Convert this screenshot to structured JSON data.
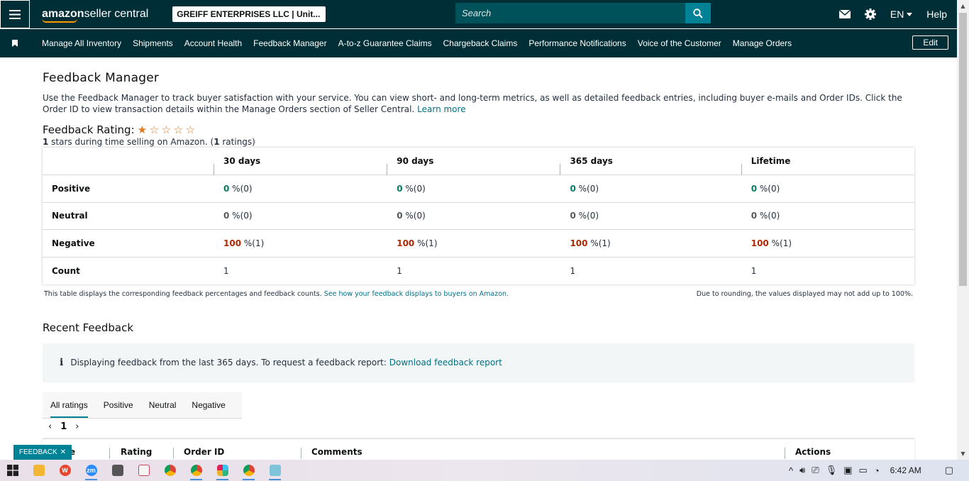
{
  "topbar": {
    "logo_bold": "amazon",
    "logo_rest": " seller central",
    "account": "GREIFF ENTERPRISES LLC | Unit...",
    "search_placeholder": "Search",
    "language": "EN",
    "help": "Help"
  },
  "navbar": {
    "items": [
      "Manage All Inventory",
      "Shipments",
      "Account Health",
      "Feedback Manager",
      "A-to-z Guarantee Claims",
      "Chargeback Claims",
      "Performance Notifications",
      "Voice of the Customer",
      "Manage Orders"
    ],
    "edit": "Edit"
  },
  "page": {
    "title": "Feedback Manager",
    "description": "Use the Feedback Manager to track buyer satisfaction with your service. You can view short- and long-term metrics, as well as detailed feedback entries, including buyer e-mails and Order IDs. Click the Order ID to view transaction details within the Manage Orders section of Seller Central.",
    "learn_more": "Learn more",
    "rating_label": "Feedback Rating:",
    "rating_value": 1,
    "rating_max": 5,
    "stars_count": "1",
    "stars_text": " stars during time selling on Amazon. (",
    "ratings_count": "1",
    "ratings_text": " ratings)"
  },
  "feedback_table": {
    "columns": [
      "30 days",
      "90 days",
      "365 days",
      "Lifetime"
    ],
    "rows": [
      {
        "label": "Positive",
        "cells": [
          {
            "num": "0",
            "rest": " %(0)"
          },
          {
            "num": "0",
            "rest": " %(0)"
          },
          {
            "num": "0",
            "rest": " %(0)"
          },
          {
            "num": "0",
            "rest": " %(0)"
          }
        ]
      },
      {
        "label": "Neutral",
        "cells": [
          {
            "num": "0",
            "rest": " %(0)"
          },
          {
            "num": "0",
            "rest": " %(0)"
          },
          {
            "num": "0",
            "rest": " %(0)"
          },
          {
            "num": "0",
            "rest": " %(0)"
          }
        ]
      },
      {
        "label": "Negative",
        "cells": [
          {
            "num": "100",
            "rest": " %(1)"
          },
          {
            "num": "100",
            "rest": " %(1)"
          },
          {
            "num": "100",
            "rest": " %(1)"
          },
          {
            "num": "100",
            "rest": " %(1)"
          }
        ]
      },
      {
        "label": "Count",
        "cells": [
          {
            "num": "",
            "rest": "1"
          },
          {
            "num": "",
            "rest": "1"
          },
          {
            "num": "",
            "rest": "1"
          },
          {
            "num": "",
            "rest": "1"
          }
        ]
      }
    ],
    "note_left": "This table displays the corresponding feedback percentages and feedback counts.",
    "note_link": "See how your feedback displays to buyers on Amazon.",
    "note_right": "Due to rounding, the values displayed may not add up to 100%."
  },
  "recent": {
    "title": "Recent Feedback",
    "info": "Displaying feedback from the last 365 days. To request a feedback report:",
    "download": "Download feedback report",
    "tabs": [
      "All ratings",
      "Positive",
      "Neutral",
      "Negative"
    ],
    "page": "1",
    "columns": [
      "e",
      "Rating",
      "Order ID",
      "Comments",
      "Actions"
    ]
  },
  "feedback_tag": "FEEDBACK",
  "taskbar": {
    "clock": "6:42 AM"
  },
  "colors": {
    "header_bg": "#002e36",
    "accent": "#008296",
    "link": "#007185",
    "positive": "#067d62",
    "negative": "#b12704",
    "star": "#de7921"
  }
}
